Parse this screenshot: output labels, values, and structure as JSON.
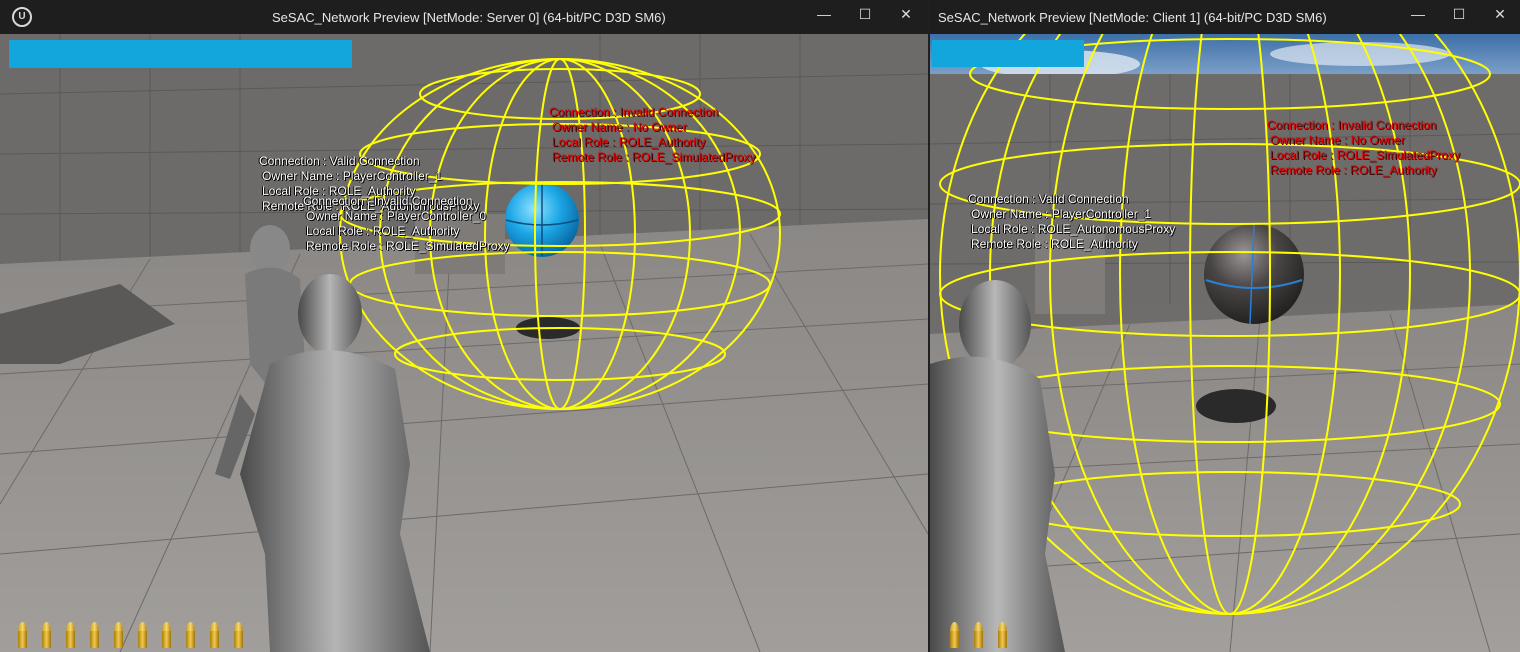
{
  "server_window": {
    "title": "SeSAC_Network Preview [NetMode: Server 0]  (64-bit/PC D3D SM6)",
    "debug_player_a": {
      "connection": "Connection : Valid Connection",
      "owner": "Owner Name : PlayerController_1",
      "local_role": "Local Role : ROLE_Authority",
      "remote_role": "Remote Role : ROLE_AutonomousProxy"
    },
    "debug_player_b": {
      "connection": "Connection : Invalid Connection",
      "owner": "Owner Name : PlayerController_0",
      "local_role": "Local Role : ROLE_Authority",
      "remote_role": "Remote Role : ROLE_SimulatedProxy"
    },
    "debug_sphere": {
      "connection": "Connection : Invalid Connection",
      "owner": "Owner Name : No Owner",
      "local_role": "Local Role : ROLE_Authority",
      "remote_role": "Remote Role : ROLE_SimulatedProxy"
    },
    "ammo_count": 10
  },
  "client_window": {
    "title": "SeSAC_Network Preview [NetMode: Client 1]  (64-bit/PC D3D SM6)",
    "debug_player": {
      "connection": "Connection : Valid Connection",
      "owner": "Owner Name : PlayerController_1",
      "local_role": "Local Role : ROLE_AutonomousProxy",
      "remote_role": "Remote Role : ROLE_Authority"
    },
    "debug_sphere": {
      "connection": "Connection : Invalid Connection",
      "owner": "Owner Name : No Owner",
      "local_role": "Local Role : ROLE_SimulatedProxy",
      "remote_role": "Remote Role : ROLE_Authority"
    },
    "ammo_count": 3
  },
  "window_controls": {
    "minimize": "—",
    "maximize": "☐",
    "close": "✕"
  },
  "colors": {
    "health_bar": "#13a6dd",
    "debug_red": "#e30000",
    "debug_white": "#ffffff",
    "wireframe": "#ffff00"
  }
}
